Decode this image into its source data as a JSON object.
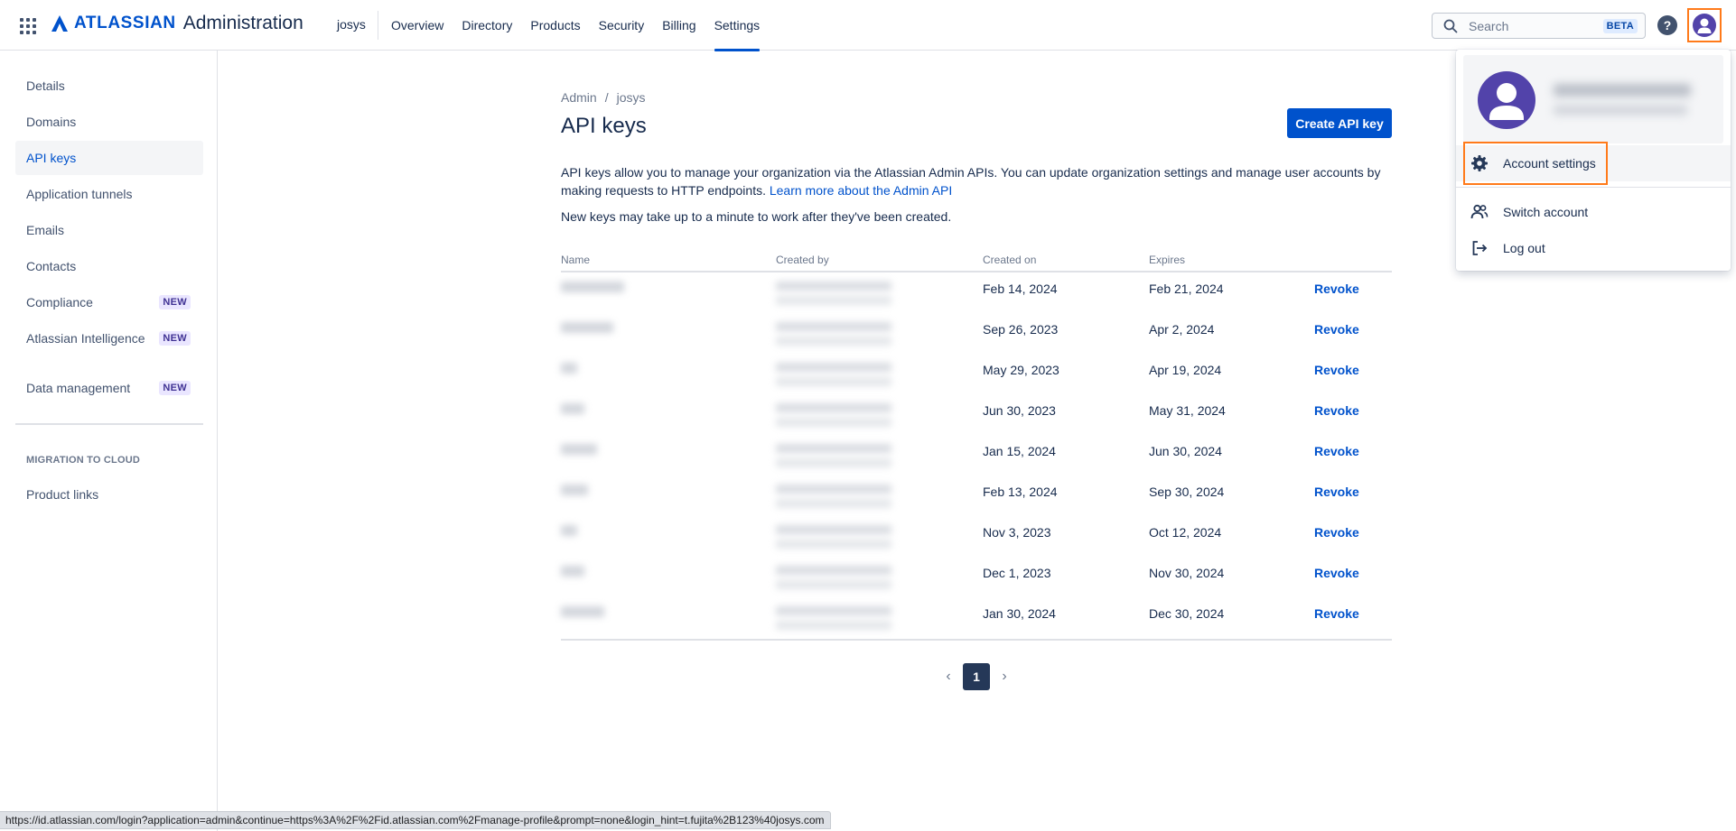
{
  "topbar": {
    "logo_word": "ATLASSIAN",
    "logo_sub": "Administration",
    "org_name": "josys",
    "nav": [
      {
        "label": "Overview"
      },
      {
        "label": "Directory"
      },
      {
        "label": "Products"
      },
      {
        "label": "Security"
      },
      {
        "label": "Billing"
      },
      {
        "label": "Settings",
        "active": true
      }
    ],
    "search_placeholder": "Search",
    "search_badge": "BETA",
    "help_glyph": "?"
  },
  "sidebar": {
    "items": [
      {
        "label": "Details"
      },
      {
        "label": "Domains"
      },
      {
        "label": "API keys",
        "active": true
      },
      {
        "label": "Application tunnels"
      },
      {
        "label": "Emails"
      },
      {
        "label": "Contacts"
      },
      {
        "label": "Compliance",
        "badge": "NEW"
      },
      {
        "label": "Atlassian Intelligence",
        "badge": "NEW"
      },
      {
        "label": "Data management",
        "badge": "NEW"
      }
    ],
    "section_title": "MIGRATION TO CLOUD",
    "section_items": [
      {
        "label": "Product links"
      }
    ]
  },
  "main": {
    "breadcrumb": [
      "Admin",
      "josys"
    ],
    "breadcrumb_sep": "/",
    "title": "API keys",
    "create_button": "Create API key",
    "description": "API keys allow you to manage your organization via the Atlassian Admin APIs. You can update organization settings and manage user accounts by making requests to HTTP endpoints.",
    "learn_more": "Learn more about the Admin API",
    "note": "New keys may take up to a minute to work after they've been created.",
    "table": {
      "headers": {
        "name": "Name",
        "created_by": "Created by",
        "created_on": "Created on",
        "expires": "Expires"
      },
      "action_label": "Revoke",
      "rows": [
        {
          "created_on": "Feb 14, 2024",
          "expires": "Feb 21, 2024"
        },
        {
          "created_on": "Sep 26, 2023",
          "expires": "Apr 2, 2024"
        },
        {
          "created_on": "May 29, 2023",
          "expires": "Apr 19, 2024"
        },
        {
          "created_on": "Jun 30, 2023",
          "expires": "May 31, 2024"
        },
        {
          "created_on": "Jan 15, 2024",
          "expires": "Jun 30, 2024"
        },
        {
          "created_on": "Feb 13, 2024",
          "expires": "Sep 30, 2024"
        },
        {
          "created_on": "Nov 3, 2023",
          "expires": "Oct 12, 2024"
        },
        {
          "created_on": "Dec 1, 2023",
          "expires": "Nov 30, 2024"
        },
        {
          "created_on": "Jan 30, 2024",
          "expires": "Dec 30, 2024"
        }
      ]
    },
    "pagination": {
      "current_page": "1"
    }
  },
  "account_menu": {
    "items": [
      {
        "label": "Account settings",
        "icon": "gear-icon"
      },
      {
        "label": "Switch account",
        "icon": "switch-account-icon"
      },
      {
        "label": "Log out",
        "icon": "log-out-icon"
      }
    ]
  },
  "status_bar": {
    "url": "https://id.atlassian.com/login?application=admin&continue=https%3A%2F%2Fid.atlassian.com%2Fmanage-profile&prompt=none&login_hint=t.fujita%2B123%40josys.com"
  },
  "colors": {
    "brand": "#0052cc",
    "highlight_outline": "#ff7a1a",
    "avatar": "#5243aa",
    "text": "#172b4d"
  }
}
